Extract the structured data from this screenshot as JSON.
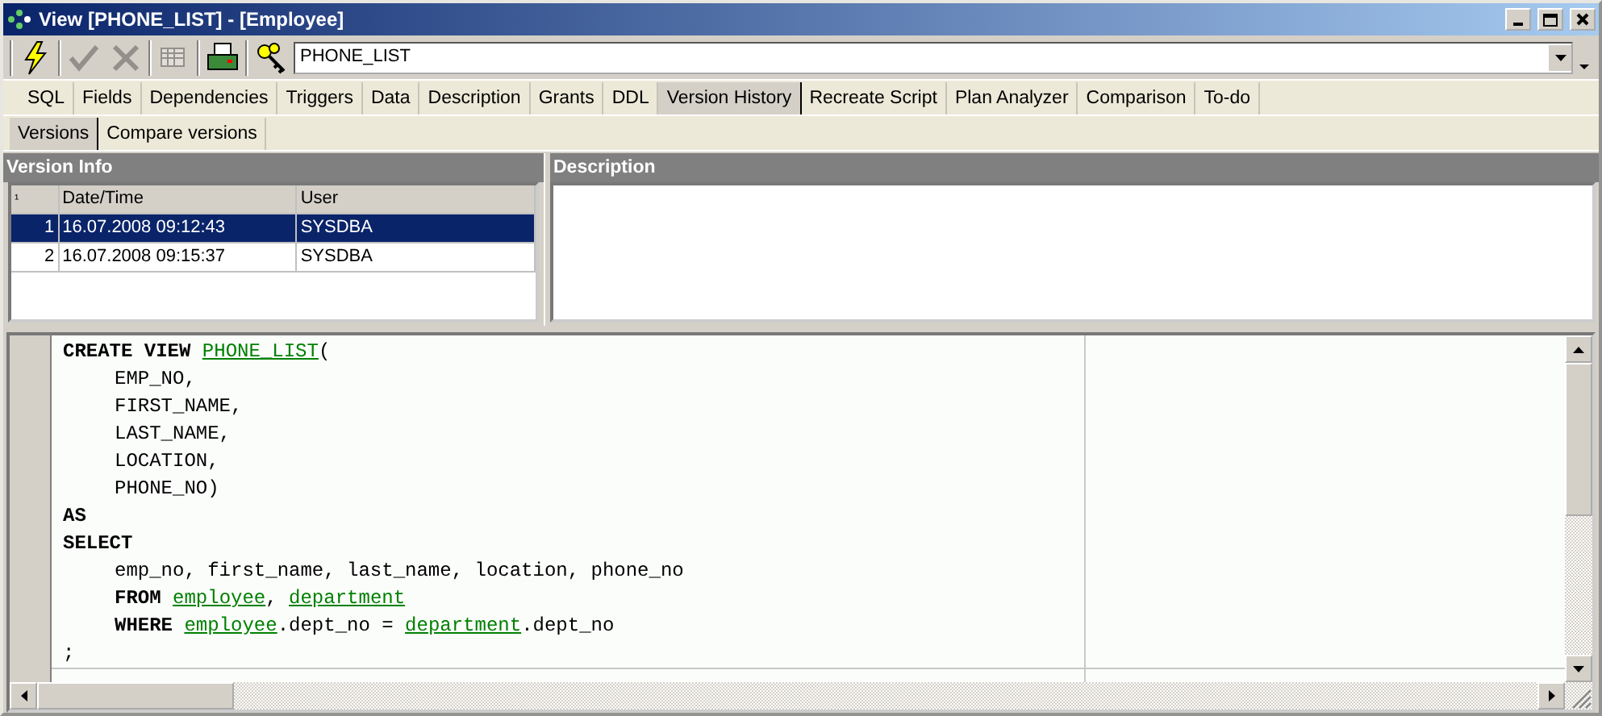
{
  "window": {
    "title": "View [PHONE_LIST] - [Employee]"
  },
  "toolbar": {
    "buttons": [
      {
        "kind": "lightning",
        "disabled": false
      },
      {
        "kind": "check",
        "disabled": true
      },
      {
        "kind": "cross",
        "disabled": true
      },
      {
        "kind": "grid",
        "disabled": true
      },
      {
        "kind": "printer",
        "disabled": false
      },
      {
        "kind": "keys",
        "disabled": false
      }
    ],
    "object_select": {
      "value": "PHONE_LIST"
    }
  },
  "tabs": [
    {
      "label": "SQL",
      "selected": false
    },
    {
      "label": "Fields",
      "selected": false
    },
    {
      "label": "Dependencies",
      "selected": false
    },
    {
      "label": "Triggers",
      "selected": false
    },
    {
      "label": "Data",
      "selected": false
    },
    {
      "label": "Description",
      "selected": false
    },
    {
      "label": "Grants",
      "selected": false
    },
    {
      "label": "DDL",
      "selected": false
    },
    {
      "label": "Version History",
      "selected": true
    },
    {
      "label": "Recreate Script",
      "selected": false
    },
    {
      "label": "Plan Analyzer",
      "selected": false
    },
    {
      "label": "Comparison",
      "selected": false
    },
    {
      "label": "To-do",
      "selected": false
    }
  ],
  "subtabs": [
    {
      "label": "Versions",
      "selected": true
    },
    {
      "label": "Compare versions",
      "selected": false
    }
  ],
  "version_info": {
    "title": "Version Info",
    "columns": [
      "¹",
      "Date/Time",
      "User"
    ],
    "rows": [
      {
        "cells": [
          "1",
          "16.07.2008 09:12:43",
          "SYSDBA"
        ],
        "selected": true
      },
      {
        "cells": [
          "2",
          "16.07.2008 09:15:37",
          "SYSDBA"
        ],
        "selected": false
      }
    ]
  },
  "description": {
    "title": "Description"
  },
  "code": {
    "lines": [
      {
        "indent": false,
        "tokens": [
          {
            "kind": "keyword",
            "text": "CREATE VIEW "
          },
          {
            "kind": "object",
            "text": "PHONE_LIST"
          },
          {
            "kind": "plain",
            "text": "("
          }
        ]
      },
      {
        "indent": true,
        "tokens": [
          {
            "kind": "plain",
            "text": "EMP_NO,"
          }
        ]
      },
      {
        "indent": true,
        "tokens": [
          {
            "kind": "plain",
            "text": "FIRST_NAME,"
          }
        ]
      },
      {
        "indent": true,
        "tokens": [
          {
            "kind": "plain",
            "text": "LAST_NAME,"
          }
        ]
      },
      {
        "indent": true,
        "tokens": [
          {
            "kind": "plain",
            "text": "LOCATION,"
          }
        ]
      },
      {
        "indent": true,
        "tokens": [
          {
            "kind": "plain",
            "text": "PHONE_NO)"
          }
        ]
      },
      {
        "indent": false,
        "tokens": [
          {
            "kind": "keyword",
            "text": "AS"
          }
        ]
      },
      {
        "indent": false,
        "tokens": [
          {
            "kind": "keyword",
            "text": "SELECT"
          }
        ]
      },
      {
        "indent": true,
        "tokens": [
          {
            "kind": "plain",
            "text": "emp_no, first_name, last_name, location, phone_no"
          }
        ]
      },
      {
        "indent": true,
        "tokens": [
          {
            "kind": "keyword",
            "text": "FROM "
          },
          {
            "kind": "object",
            "text": "employee"
          },
          {
            "kind": "plain",
            "text": ", "
          },
          {
            "kind": "object",
            "text": "department"
          }
        ]
      },
      {
        "indent": true,
        "tokens": [
          {
            "kind": "keyword",
            "text": "WHERE "
          },
          {
            "kind": "object",
            "text": "employee"
          },
          {
            "kind": "plain",
            "text": ".dept_no = "
          },
          {
            "kind": "object",
            "text": "department"
          },
          {
            "kind": "plain",
            "text": ".dept_no"
          }
        ]
      },
      {
        "indent": false,
        "tokens": [
          {
            "kind": "plain",
            "text": ";"
          }
        ]
      }
    ]
  }
}
